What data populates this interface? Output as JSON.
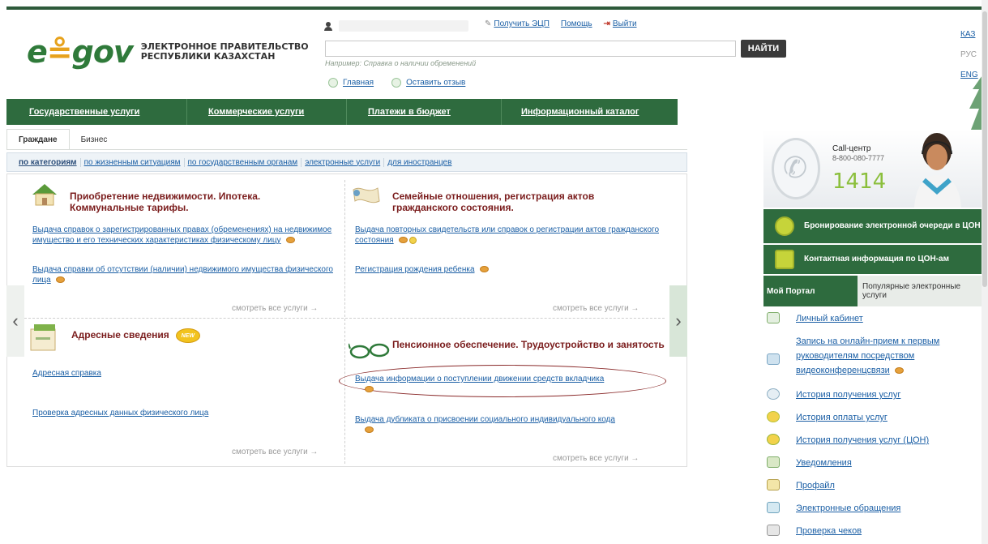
{
  "header": {
    "logo_text": "egov",
    "title_line1": "ЭЛЕКТРОННОЕ ПРАВИТЕЛЬСТВО",
    "title_line2": "РЕСПУБЛИКИ КАЗАХСТАН",
    "get_eds": "Получить ЭЦП",
    "help": "Помощь",
    "logout": "Выйти",
    "search_placeholder": "",
    "search_hint": "Например: Справка о наличии обременений",
    "search_button": "НАЙТИ",
    "home": "Главная",
    "feedback": "Оставить отзыв",
    "languages": [
      "КАЗ",
      "РУС",
      "ENG"
    ]
  },
  "mainnav": [
    "Государственные услуги",
    "Коммерческие услуги",
    "Платежи в бюджет",
    "Информационный каталог"
  ],
  "tabs": [
    "Граждане",
    "Бизнес"
  ],
  "subcategories": [
    "по категориям",
    "по жизненным ситуациям",
    "по государственным органам",
    "электронные услуги",
    "для иностранцев"
  ],
  "sections": {
    "realty": {
      "title": "Приобретение недвижимости. Ипотека. Коммунальные тарифы.",
      "items": [
        "Выдача справок о зарегистрированных правах (обременениях) на недвижимое имущество и его технических характеристиках физическому лицу",
        "Выдача справки об отсутствии (наличии) недвижимого имущества физического лица"
      ],
      "more": "смотреть все услуги →"
    },
    "family": {
      "title": "Семейные отношения, регистрация актов гражданского состояния.",
      "items": [
        "Выдача повторных свидетельств или справок о регистрации актов гражданского состояния",
        "Регистрация рождения ребенка"
      ],
      "more": "смотреть все услуги →"
    },
    "address": {
      "title": "Адресные сведения",
      "badge": "NEW",
      "items": [
        "Адресная справка",
        "Проверка адресных данных физического лица"
      ],
      "more": "смотреть все услуги →"
    },
    "pension": {
      "title": "Пенсионное обеспечение. Трудоустройство и занятость",
      "items": [
        "Выдача информации о поступлении движении средств вкладчика",
        "Выдача дубликата о присвоении социального индивидуального кода"
      ],
      "more": "смотреть все услуги →"
    }
  },
  "callcenter": {
    "title": "Call-центр",
    "phone": "8-800-080-7777",
    "short": "1414"
  },
  "right_buttons": {
    "queue": "Бронирование электронной очереди в ЦОН",
    "contacts": "Контактная информация по ЦОН-ам"
  },
  "right_tabs": [
    "Мой Портал",
    "Популярные электронные услуги"
  ],
  "portal_items": [
    "Личный кабинет",
    "Запись на онлайн-прием к первым руководителям посредством видеоконференцсвязи",
    "История получения услуг",
    "История оплаты услуг",
    "История получения услуг (ЦОН)",
    "Уведомления",
    "Профайл",
    "Электронные обращения",
    "Проверка чеков"
  ],
  "colors": {
    "brand_green": "#2e6b3e",
    "link_blue": "#1b5fa5",
    "section_title": "#7a1c1c"
  }
}
